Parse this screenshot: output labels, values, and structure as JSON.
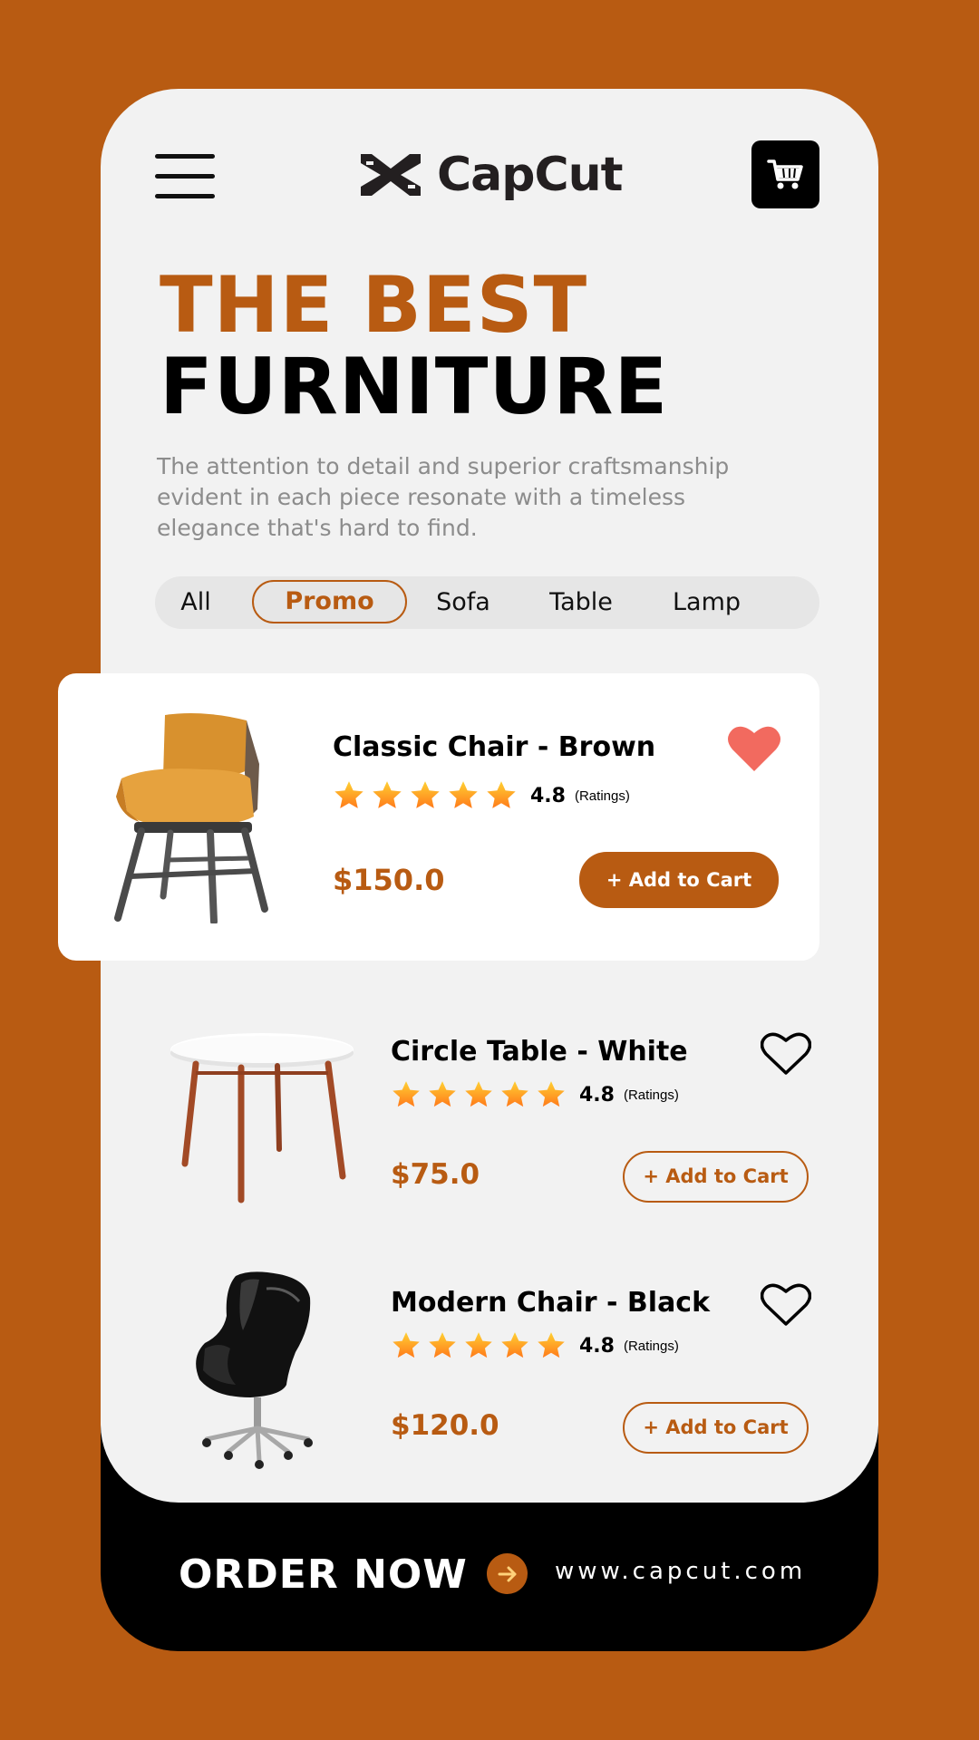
{
  "app": {
    "brand_name": "CapCut",
    "background_color": "#b85b12",
    "accent_color": "#b85b12"
  },
  "header": {
    "menu_icon": "hamburger-menu-icon",
    "cart_icon": "shopping-cart-icon"
  },
  "hero": {
    "headline_line1": "THE BEST",
    "headline_line2": "FURNITURE",
    "description": "The attention to detail and superior craftsmanship evident in each piece resonate with a timeless elegance that's hard to find."
  },
  "tabs": [
    {
      "label": "All",
      "active": false
    },
    {
      "label": "Promo",
      "active": true
    },
    {
      "label": "Sofa",
      "active": false
    },
    {
      "label": "Table",
      "active": false
    },
    {
      "label": "Lamp",
      "active": false
    }
  ],
  "products": [
    {
      "name": "Classic Chair - Brown",
      "rating": "4.8",
      "rating_label": "(Ratings)",
      "stars": 5,
      "price": "$150.0",
      "cta": "+ Add to Cart",
      "favorited": true,
      "image_icon": "brown-chair-image"
    },
    {
      "name": "Circle Table - White",
      "rating": "4.8",
      "rating_label": "(Ratings)",
      "stars": 5,
      "price": "$75.0",
      "cta": "+ Add to Cart",
      "favorited": false,
      "image_icon": "white-table-image"
    },
    {
      "name": "Modern Chair - Black",
      "rating": "4.8",
      "rating_label": "(Ratings)",
      "stars": 5,
      "price": "$120.0",
      "cta": "+ Add to Cart",
      "favorited": false,
      "image_icon": "black-chair-image"
    }
  ],
  "footer": {
    "order_label": "ORDER NOW",
    "arrow_icon": "arrow-right-icon",
    "url": "www.capcut.com"
  }
}
